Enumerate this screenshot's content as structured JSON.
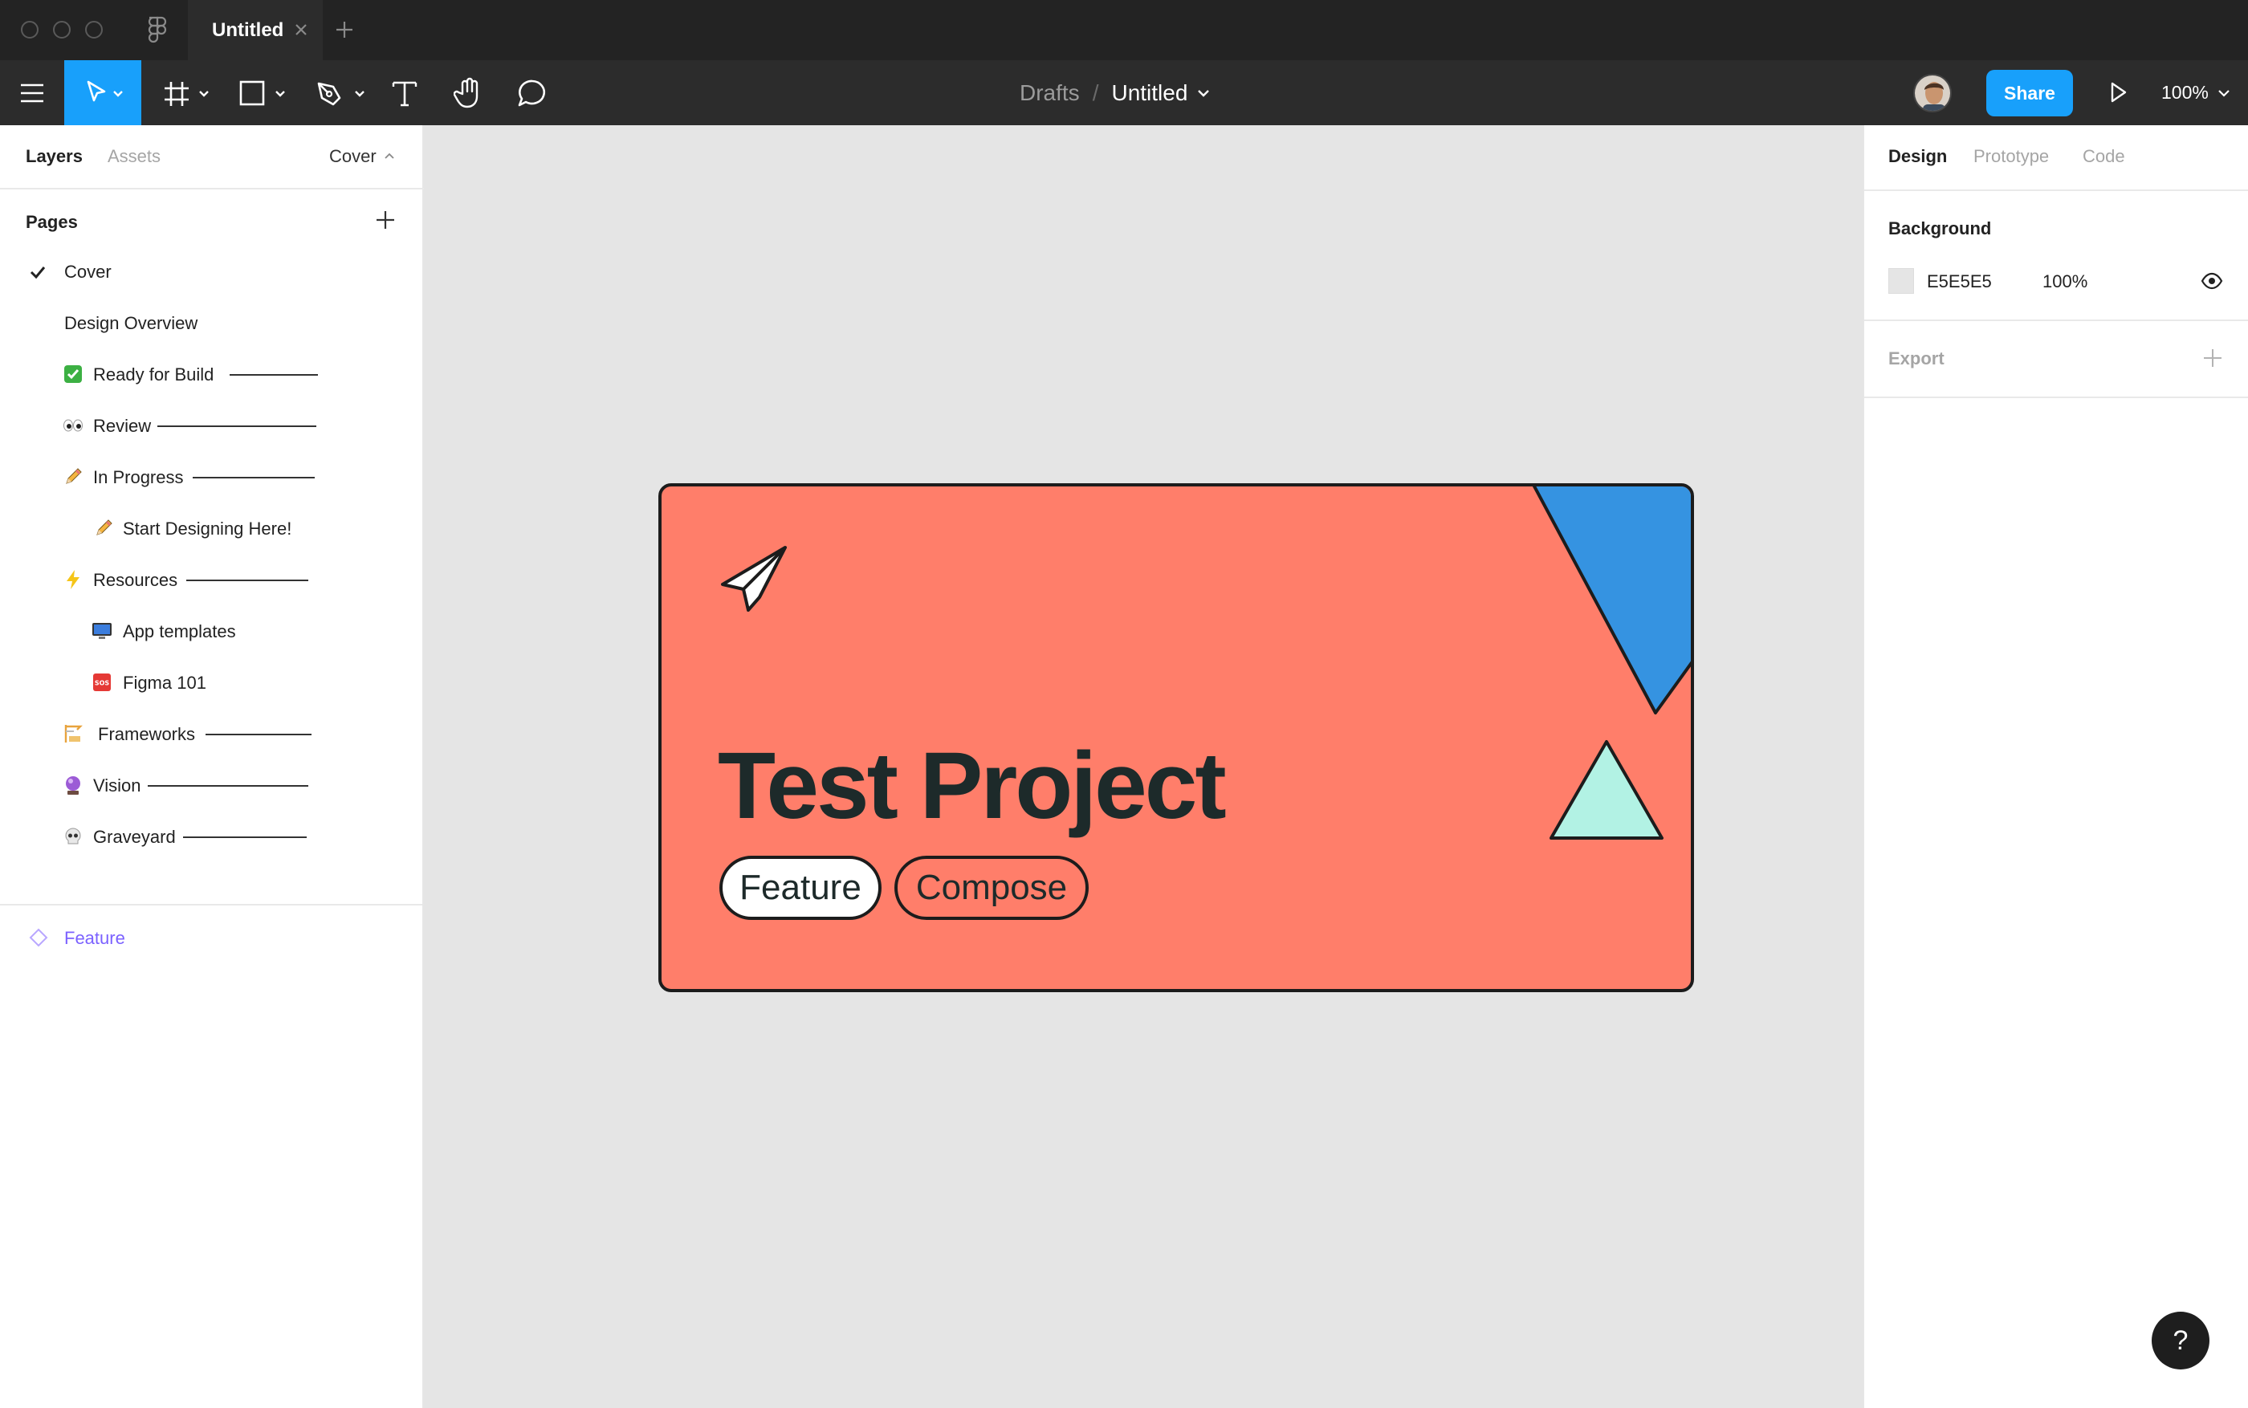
{
  "titlebar": {
    "tab_title": "Untitled"
  },
  "toolbar": {
    "breadcrumb_drafts": "Drafts",
    "breadcrumb_sep": "/",
    "file_name": "Untitled",
    "share_label": "Share",
    "zoom_level": "100%"
  },
  "left_panel": {
    "tab_layers": "Layers",
    "tab_assets": "Assets",
    "current_page": "Cover",
    "pages_header": "Pages",
    "pages": [
      {
        "label": "Cover",
        "emoji": "",
        "selected": true
      },
      {
        "label": "Design Overview",
        "emoji": ""
      },
      {
        "label": "Ready for Build",
        "emoji": "✅"
      },
      {
        "label": "Review",
        "emoji": "👀"
      },
      {
        "label": "In Progress",
        "emoji": "✏️"
      },
      {
        "label": "Start Designing Here!",
        "emoji": "✏️"
      },
      {
        "label": "Resources",
        "emoji": "⚡"
      },
      {
        "label": "App templates",
        "emoji": "🖥️"
      },
      {
        "label": "Figma 101",
        "emoji": "🆘"
      },
      {
        "label": "Frameworks",
        "emoji": "🏗️"
      },
      {
        "label": "Vision",
        "emoji": "🔮"
      },
      {
        "label": "Graveyard",
        "emoji": "💀"
      }
    ],
    "layer_name": "Feature"
  },
  "right_panel": {
    "tab_design": "Design",
    "tab_prototype": "Prototype",
    "tab_code": "Code",
    "background_title": "Background",
    "background_hex": "E5E5E5",
    "background_opacity": "100%",
    "export_title": "Export"
  },
  "canvas": {
    "cover_title": "Test Project",
    "pill_feature": "Feature",
    "pill_compose": "Compose",
    "card_color": "#ff7e6a",
    "accent_blue": "#3593e1",
    "accent_mint": "#b2f2e4"
  },
  "help_label": "?",
  "colors": {
    "accent": "#18a0fb",
    "layer_purple": "#7b61ff"
  }
}
